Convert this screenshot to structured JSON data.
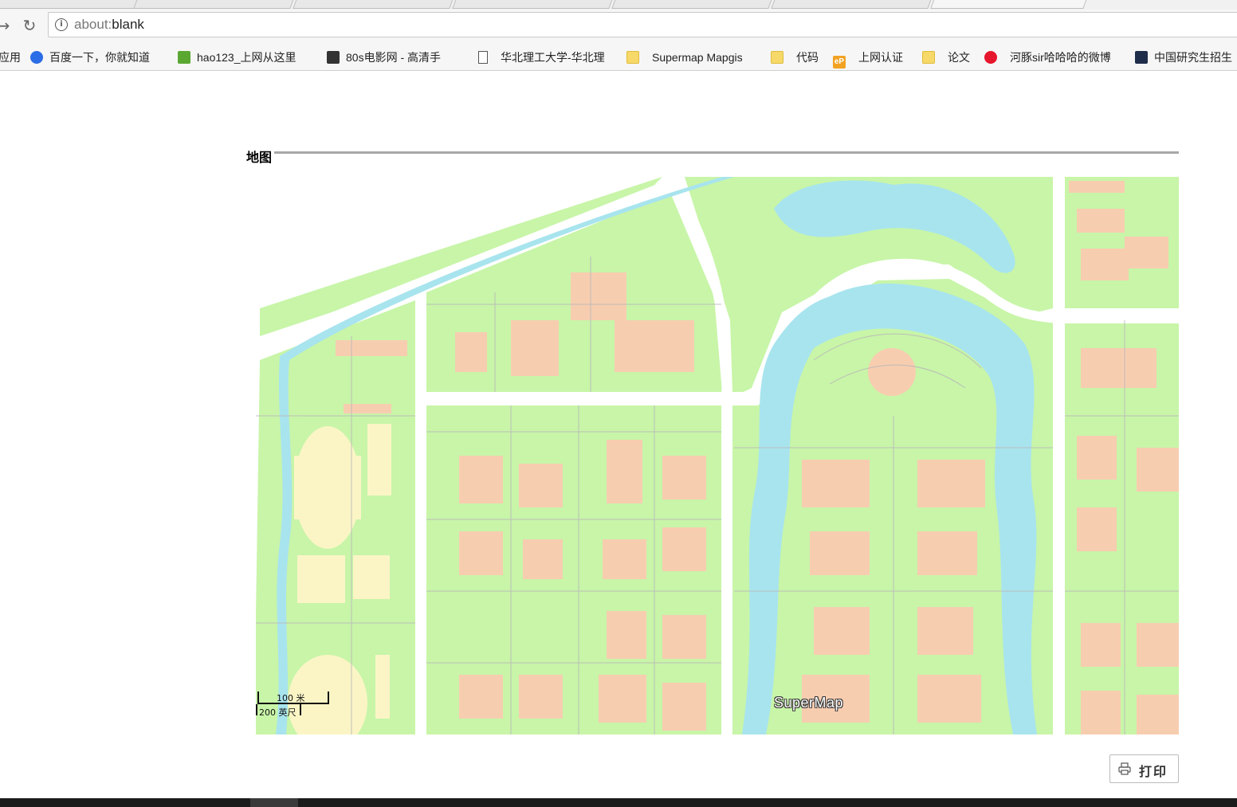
{
  "browser": {
    "address": {
      "scheme": "about:",
      "path": "blank"
    },
    "bookmarks": [
      {
        "label": "应用",
        "icon": "apps-icon"
      },
      {
        "label": "百度一下，你就知道",
        "icon": "baidu-icon"
      },
      {
        "label": "hao123_上网从这里",
        "icon": "hao123-icon"
      },
      {
        "label": "80s电影网 - 高清手",
        "icon": "film-icon"
      },
      {
        "label": "华北理工大学-华北理",
        "icon": "page-icon"
      },
      {
        "label": "Supermap Mapgis",
        "icon": "folder-icon"
      },
      {
        "label": "代码",
        "icon": "folder-icon"
      },
      {
        "label": "上网认证",
        "icon": "ep-icon"
      },
      {
        "label": "论文",
        "icon": "folder-icon"
      },
      {
        "label": "河豚sir哈哈哈的微博",
        "icon": "weibo-icon"
      },
      {
        "label": "中国研究生招生",
        "icon": "graduation-cap-icon"
      }
    ]
  },
  "page": {
    "section_title": "地图",
    "map": {
      "logo": "SuperMap",
      "scale_metric": "100 米",
      "scale_imperial": "200 英尺",
      "colors": {
        "green_space": "#c8f5a8",
        "building": "#f7cdb0",
        "water": "#a8e4ee",
        "sports_field": "#fbf5c6",
        "road": "#ffffff",
        "path": "#b9b9b9"
      }
    },
    "print_button": {
      "label": "打印",
      "icon": "printer-icon"
    }
  }
}
